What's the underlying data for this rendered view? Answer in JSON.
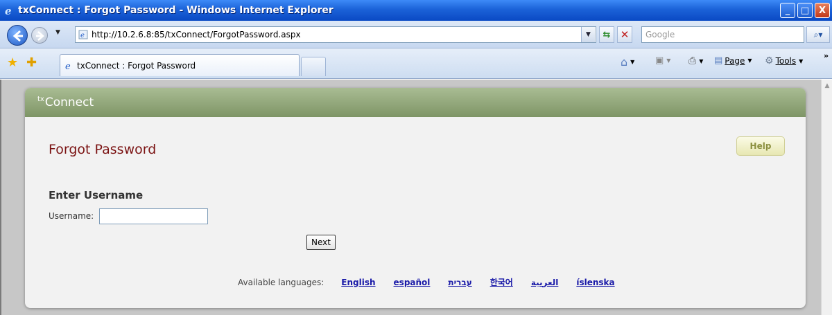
{
  "window": {
    "title": "txConnect : Forgot Password - Windows Internet Explorer",
    "minimize": "_",
    "maximize": "□",
    "close": "X"
  },
  "navbar": {
    "url": "http://10.2.6.8:85/txConnect/ForgotPassword.aspx",
    "search_placeholder": "Google"
  },
  "tabbar": {
    "active_tab": "txConnect : Forgot Password",
    "page_menu": "Page",
    "tools_menu": "Tools"
  },
  "page": {
    "logo_prefix": "tx",
    "logo_text": "Connect",
    "title": "Forgot Password",
    "help_label": "Help",
    "section_heading": "Enter Username",
    "username_label": "Username:",
    "username_value": "",
    "next_label": "Next",
    "languages_label": "Available languages:",
    "languages": [
      "English",
      "español",
      "עברית",
      "한국어",
      "العربية",
      "íslenska"
    ]
  },
  "colors": {
    "title_bar": "#1b62d8",
    "header_green": "#8fa576",
    "title_red": "#7b1313",
    "link_blue": "#1a1aa8"
  }
}
